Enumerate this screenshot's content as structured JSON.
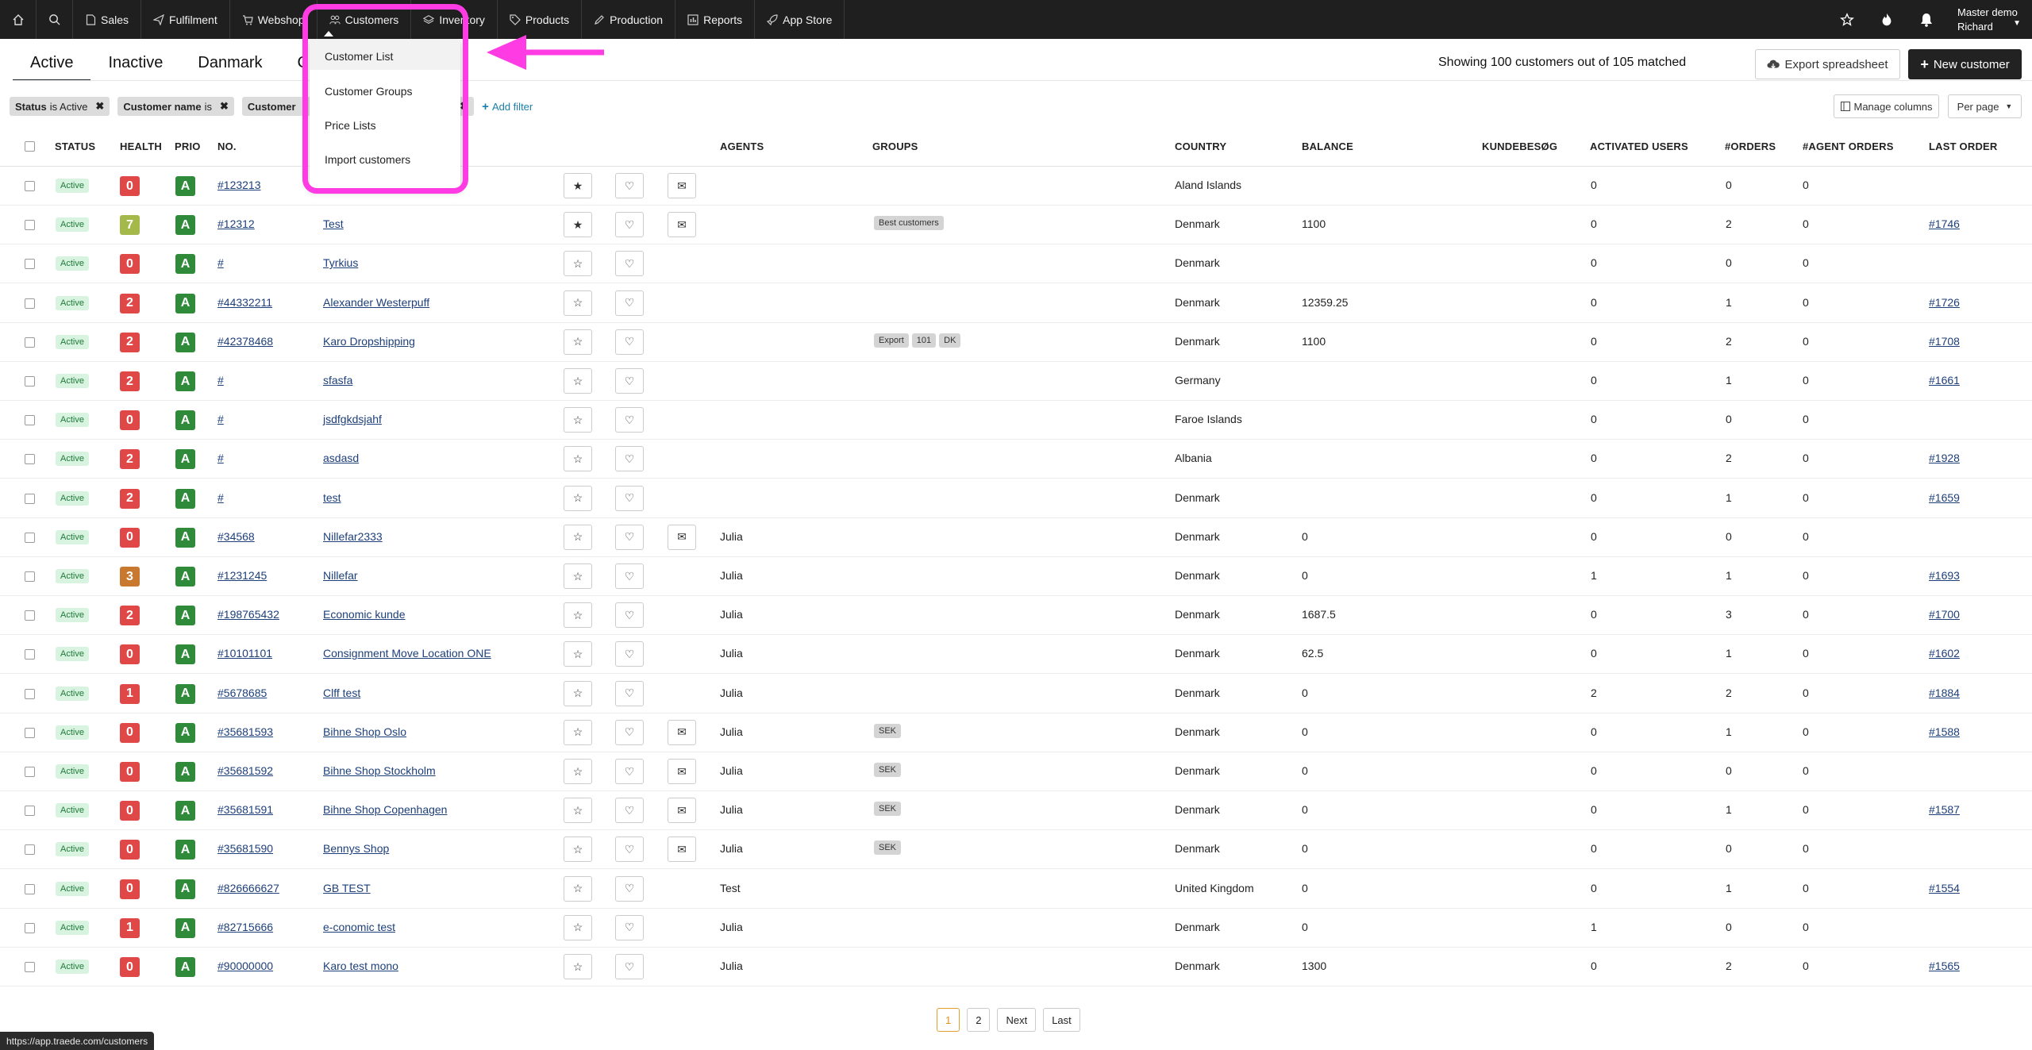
{
  "nav": {
    "items": [
      {
        "label": "Sales",
        "icon": "document-icon"
      },
      {
        "label": "Fulfilment",
        "icon": "paper-plane-icon"
      },
      {
        "label": "Webshop",
        "icon": "cart-icon"
      },
      {
        "label": "Customers",
        "icon": "users-icon"
      },
      {
        "label": "Inventory",
        "icon": "layers-icon"
      },
      {
        "label": "Products",
        "icon": "tag-icon"
      },
      {
        "label": "Production",
        "icon": "pencil-icon"
      },
      {
        "label": "Reports",
        "icon": "bar-chart-icon"
      },
      {
        "label": "App Store",
        "icon": "rocket-icon"
      }
    ],
    "user_line1": "Master demo",
    "user_line2": "Richard"
  },
  "tabs": [
    "Active",
    "Inactive",
    "Danmark",
    "Cu"
  ],
  "showing_text": "Showing 100 customers out of 105 matched",
  "export_label": "Export spreadsheet",
  "new_customer_label": "New customer",
  "filters": [
    {
      "field": "Status",
      "op": "is Active"
    },
    {
      "field": "Customer name",
      "op": "is"
    },
    {
      "field": "Customer",
      "op": ""
    },
    {
      "field": "",
      "op": "is"
    }
  ],
  "add_filter_label": "Add filter",
  "manage_columns_label": "Manage columns",
  "per_page_label": "Per page",
  "columns": {
    "status": "STATUS",
    "health": "HEALTH",
    "prio": "PRIO",
    "no": "NO.",
    "agents": "AGENTS",
    "groups": "GROUPS",
    "country": "COUNTRY",
    "balance": "BALANCE",
    "kundebesog": "KUNDEBESØG",
    "activated": "ACTIVATED USERS",
    "orders": "#ORDERS",
    "agent_orders": "#AGENT ORDERS",
    "last_order": "LAST ORDER"
  },
  "rows": [
    {
      "status": "Active",
      "health": "0",
      "no": "#123213",
      "name": "",
      "star": "filled",
      "mail": true,
      "agent": "",
      "groups": [],
      "country": "Aland Islands",
      "balance": "",
      "activated": "0",
      "orders": "0",
      "agent_orders": "0",
      "last": ""
    },
    {
      "status": "Active",
      "health": "7",
      "no": "#12312",
      "name": "Test",
      "star": "filled",
      "mail": true,
      "agent": "",
      "groups": [
        "Best customers"
      ],
      "country": "Denmark",
      "balance": "1100",
      "activated": "0",
      "orders": "2",
      "agent_orders": "0",
      "last": "#1746"
    },
    {
      "status": "Active",
      "health": "0",
      "no": "#",
      "name": "Tyrkius",
      "star": "empty",
      "mail": false,
      "agent": "",
      "groups": [],
      "country": "Denmark",
      "balance": "",
      "activated": "0",
      "orders": "0",
      "agent_orders": "0",
      "last": ""
    },
    {
      "status": "Active",
      "health": "2",
      "no": "#44332211",
      "name": "Alexander Westerpuff",
      "star": "empty",
      "mail": false,
      "agent": "",
      "groups": [],
      "country": "Denmark",
      "balance": "12359.25",
      "activated": "0",
      "orders": "1",
      "agent_orders": "0",
      "last": "#1726"
    },
    {
      "status": "Active",
      "health": "2",
      "no": "#42378468",
      "name": "Karo Dropshipping",
      "star": "empty",
      "mail": false,
      "agent": "",
      "groups": [
        "Export",
        "101",
        "DK"
      ],
      "country": "Denmark",
      "balance": "1100",
      "activated": "0",
      "orders": "2",
      "agent_orders": "0",
      "last": "#1708"
    },
    {
      "status": "Active",
      "health": "2",
      "no": "#",
      "name": "sfasfa",
      "star": "empty",
      "mail": false,
      "agent": "",
      "groups": [],
      "country": "Germany",
      "balance": "",
      "activated": "0",
      "orders": "1",
      "agent_orders": "0",
      "last": "#1661"
    },
    {
      "status": "Active",
      "health": "0",
      "no": "#",
      "name": "jsdfgkdsjahf",
      "star": "empty",
      "mail": false,
      "agent": "",
      "groups": [],
      "country": "Faroe Islands",
      "balance": "",
      "activated": "0",
      "orders": "0",
      "agent_orders": "0",
      "last": ""
    },
    {
      "status": "Active",
      "health": "2",
      "no": "#",
      "name": "asdasd",
      "star": "empty",
      "mail": false,
      "agent": "",
      "groups": [],
      "country": "Albania",
      "balance": "",
      "activated": "0",
      "orders": "2",
      "agent_orders": "0",
      "last": "#1928"
    },
    {
      "status": "Active",
      "health": "2",
      "no": "#",
      "name": "test",
      "star": "empty",
      "mail": false,
      "agent": "",
      "groups": [],
      "country": "Denmark",
      "balance": "",
      "activated": "0",
      "orders": "1",
      "agent_orders": "0",
      "last": "#1659"
    },
    {
      "status": "Active",
      "health": "0",
      "no": "#34568",
      "name": "Nillefar2333",
      "star": "empty",
      "mail": true,
      "agent": "Julia",
      "groups": [],
      "country": "Denmark",
      "balance": "0",
      "activated": "0",
      "orders": "0",
      "agent_orders": "0",
      "last": ""
    },
    {
      "status": "Active",
      "health": "3",
      "no": "#1231245",
      "name": "Nillefar",
      "star": "empty",
      "mail": false,
      "agent": "Julia",
      "groups": [],
      "country": "Denmark",
      "balance": "0",
      "activated": "1",
      "orders": "1",
      "agent_orders": "0",
      "last": "#1693"
    },
    {
      "status": "Active",
      "health": "2",
      "no": "#198765432",
      "name": "Economic kunde",
      "star": "empty",
      "mail": false,
      "agent": "Julia",
      "groups": [],
      "country": "Denmark",
      "balance": "1687.5",
      "activated": "0",
      "orders": "3",
      "agent_orders": "0",
      "last": "#1700"
    },
    {
      "status": "Active",
      "health": "0",
      "no": "#10101101",
      "name": "Consignment Move Location ONE",
      "star": "empty",
      "mail": false,
      "agent": "Julia",
      "groups": [],
      "country": "Denmark",
      "balance": "62.5",
      "activated": "0",
      "orders": "1",
      "agent_orders": "0",
      "last": "#1602"
    },
    {
      "status": "Active",
      "health": "1",
      "no": "#5678685",
      "name": "Clff test",
      "star": "empty",
      "mail": false,
      "agent": "Julia",
      "groups": [],
      "country": "Denmark",
      "balance": "0",
      "activated": "2",
      "orders": "2",
      "agent_orders": "0",
      "last": "#1884"
    },
    {
      "status": "Active",
      "health": "0",
      "no": "#35681593",
      "name": "Bihne Shop Oslo",
      "star": "empty",
      "mail": true,
      "agent": "Julia",
      "groups": [
        "SEK"
      ],
      "country": "Denmark",
      "balance": "0",
      "activated": "0",
      "orders": "1",
      "agent_orders": "0",
      "last": "#1588"
    },
    {
      "status": "Active",
      "health": "0",
      "no": "#35681592",
      "name": "Bihne Shop Stockholm",
      "star": "empty",
      "mail": true,
      "agent": "Julia",
      "groups": [
        "SEK"
      ],
      "country": "Denmark",
      "balance": "0",
      "activated": "0",
      "orders": "0",
      "agent_orders": "0",
      "last": ""
    },
    {
      "status": "Active",
      "health": "0",
      "no": "#35681591",
      "name": "Bihne Shop Copenhagen",
      "star": "empty",
      "mail": true,
      "agent": "Julia",
      "groups": [
        "SEK"
      ],
      "country": "Denmark",
      "balance": "0",
      "activated": "0",
      "orders": "1",
      "agent_orders": "0",
      "last": "#1587"
    },
    {
      "status": "Active",
      "health": "0",
      "no": "#35681590",
      "name": "Bennys Shop",
      "star": "empty",
      "mail": true,
      "agent": "Julia",
      "groups": [
        "SEK"
      ],
      "country": "Denmark",
      "balance": "0",
      "activated": "0",
      "orders": "0",
      "agent_orders": "0",
      "last": ""
    },
    {
      "status": "Active",
      "health": "0",
      "no": "#826666627",
      "name": "GB TEST",
      "star": "empty",
      "mail": false,
      "agent": "Test",
      "groups": [],
      "country": "United Kingdom",
      "balance": "0",
      "activated": "0",
      "orders": "1",
      "agent_orders": "0",
      "last": "#1554"
    },
    {
      "status": "Active",
      "health": "1",
      "no": "#82715666",
      "name": "e-conomic test",
      "star": "empty",
      "mail": false,
      "agent": "Julia",
      "groups": [],
      "country": "Denmark",
      "balance": "0",
      "activated": "1",
      "orders": "0",
      "agent_orders": "0",
      "last": ""
    },
    {
      "status": "Active",
      "health": "0",
      "no": "#90000000",
      "name": "Karo test mono",
      "star": "empty",
      "mail": false,
      "agent": "Julia",
      "groups": [],
      "country": "Denmark",
      "balance": "1300",
      "activated": "0",
      "orders": "2",
      "agent_orders": "0",
      "last": "#1565"
    }
  ],
  "prio_value": "A",
  "health_colors": {
    "0": "#e04848",
    "1": "#e04848",
    "2": "#e04848",
    "3": "#c9782f",
    "7": "#a5b94a"
  },
  "pager": [
    "1",
    "2",
    "Next",
    "Last"
  ],
  "dropdown": [
    "Customer List",
    "Customer Groups",
    "Price Lists",
    "Import customers"
  ],
  "status_url": "https://app.traede.com/customers"
}
